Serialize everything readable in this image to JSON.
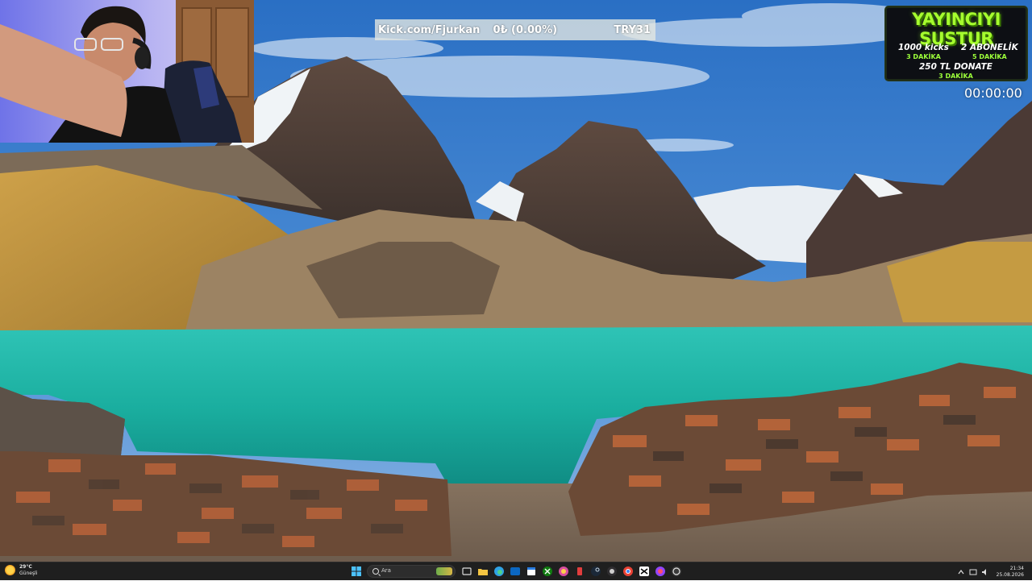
{
  "ticker": {
    "channel": "Kick.com/Fjurkan",
    "change": "0₺ (0.00%)",
    "symbol": "TRY31"
  },
  "overlay": {
    "title": "YAYINCIYI SUSTUR",
    "items": [
      {
        "label": "1000 kicks",
        "duration": "3 DAKİKA"
      },
      {
        "label": "2 ABONELİK",
        "duration": "5 DAKİKA"
      },
      {
        "label": "250 TL DONATE",
        "duration": "3 DAKİKA"
      }
    ],
    "timer": "00:00:00"
  },
  "taskbar": {
    "weather": {
      "temp": "29°C",
      "condition": "Güneşli"
    },
    "search_placeholder": "Ara",
    "pinned_apps": [
      "explorer-icon",
      "edge-icon",
      "outlook-icon",
      "calendar-icon",
      "xbox-icon",
      "photos-icon",
      "app-icon",
      "steam-icon",
      "chrome-icon",
      "capcut-icon",
      "app-icon-2",
      "obs-icon"
    ],
    "clock": {
      "time": "21:34",
      "date": "25.08.2026"
    }
  },
  "colors": {
    "overlay_green": "#a6ff2e",
    "taskbar_bg": "#1f1f1f",
    "lake": "#1fb3a6"
  }
}
